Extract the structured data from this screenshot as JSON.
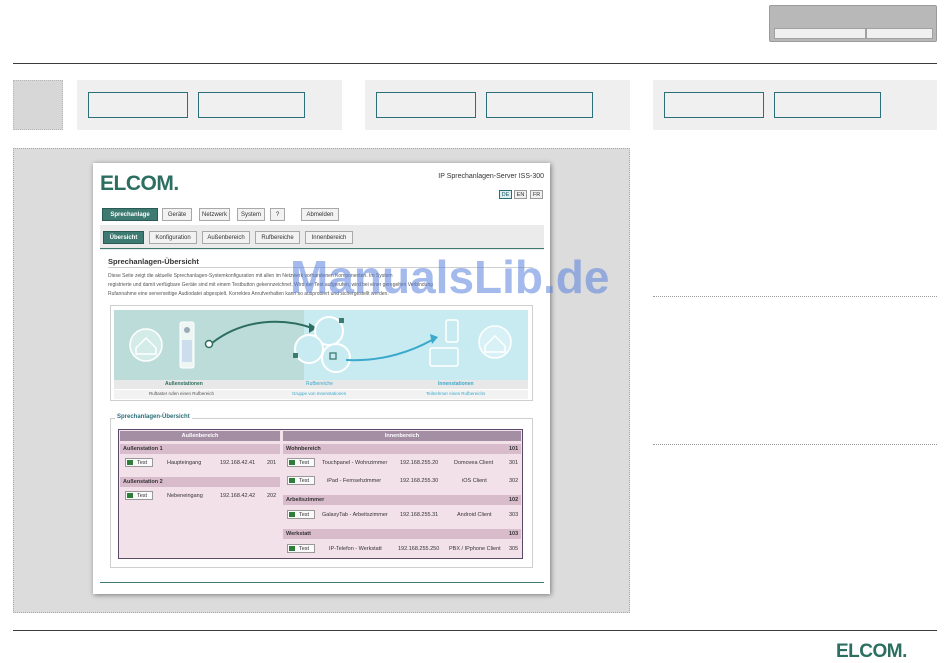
{
  "screenshot": {
    "brand": "ELCOM.",
    "product_title": "IP Sprechanlagen-Server ISS-300",
    "languages": [
      "DE",
      "EN",
      "FR"
    ],
    "main_tabs": [
      "Sprechanlage",
      "Geräte",
      "Netzwerk",
      "System",
      "?",
      "Abmelden"
    ],
    "sub_tabs": [
      "Übersicht",
      "Konfiguration",
      "Außenbereich",
      "Rufbereiche",
      "Innenbereich"
    ],
    "section_title": "Sprechanlagen-Übersicht",
    "intro_lines": [
      "Diese Seite zeigt die aktuelle Sprechanlagen-Systemkonfiguration mit allen im Netzwerk vorhandenen Komponenten. Im System",
      "registrierte und damit verfügbare Geräte sind mit einem Testbutton gekennzeichnet. Wird der Test aufgerufen, wird bei einer geregelten Verbindung",
      "Rufannahme eine serverseitige Audiodatei abgespielt. Korrektes Anrufverhalten kann so ausprobiert und sichergestellt werden."
    ],
    "diagram_labels": {
      "left": "Außenstationen",
      "left_sub": "Ruftaster rufen einen Rufbereich",
      "middle": "Rufbereiche",
      "middle_sub": "Gruppe von Innenstationen",
      "right": "Innenstationen",
      "right_sub": "Teilnehmer eines Rufbereichs"
    },
    "overview_title": "Sprechanlagen-Übersicht",
    "overview_headers": {
      "left": "Außenbereich",
      "right": "Innenbereich"
    },
    "test_label": "Test",
    "outdoor": [
      {
        "name": "Außenstation 1",
        "label": "Haupteingang",
        "ip": "192.168.42.41",
        "num": "201"
      },
      {
        "name": "Außenstation 2",
        "label": "Nebeneingang",
        "ip": "192.168.42.42",
        "num": "202"
      }
    ],
    "indoor": [
      {
        "area": "Wohnbereich",
        "area_num": "101",
        "devices": [
          {
            "label": "Touchpanel - Wohnzimmer",
            "ip": "192.168.255.20",
            "client": "Domovea Client",
            "num": "301"
          },
          {
            "label": "iPad - Fernsehzimmer",
            "ip": "192.168.255.30",
            "client": "iOS Client",
            "num": "302"
          }
        ]
      },
      {
        "area": "Arbeitszimmer",
        "area_num": "102",
        "devices": [
          {
            "label": "GalaxyTab - Arbeitszimmer",
            "ip": "192.168.255.31",
            "client": "Android Client",
            "num": "303"
          }
        ]
      },
      {
        "area": "Werkstatt",
        "area_num": "103",
        "devices": [
          {
            "label": "IP-Telefon - Werkstatt",
            "ip": "192.168.255.250",
            "client": "PBX / IPphone Client",
            "num": "305"
          }
        ]
      }
    ]
  },
  "watermark": "ManualsLib.de",
  "footer_brand": "ELCOM.",
  "colors": {
    "brand": "#2c6e60",
    "accent": "#3c7a72",
    "overview_bg": "#f3e1e9",
    "diagram_bg": "#c8ebf2"
  }
}
